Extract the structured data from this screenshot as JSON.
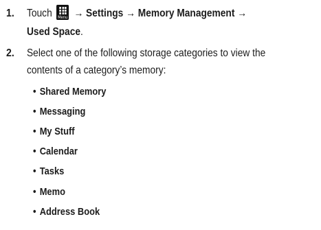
{
  "steps": [
    {
      "number": "1.",
      "prefix": "Touch",
      "icon_label": "Menu",
      "icon": "menu-grid-icon",
      "path_line1": "→ Settings → Memory Management →",
      "path_line2": "Used Space",
      "end": "."
    },
    {
      "number": "2.",
      "line1": "Select one of the following storage categories to view the",
      "line2": "contents of a category’s memory:"
    }
  ],
  "categories": [
    "Shared Memory",
    "Messaging",
    "My Stuff",
    "Calendar",
    "Tasks",
    "Memo",
    "Address Book"
  ],
  "bullet_char": "•"
}
